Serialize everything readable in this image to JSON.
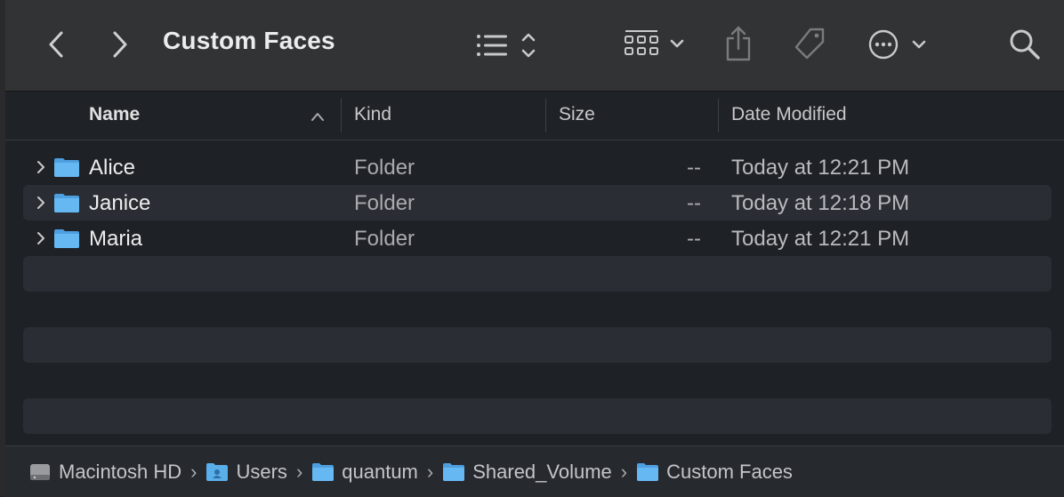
{
  "window": {
    "title": "Custom Faces"
  },
  "toolbar": {
    "back_icon": "chevron-left-icon",
    "forward_icon": "chevron-right-icon",
    "view_icon": "list-view-icon",
    "group_icon": "group-grid-icon",
    "share_icon": "share-icon",
    "tag_icon": "tag-icon",
    "more_icon": "ellipsis-circle-icon",
    "search_icon": "search-icon"
  },
  "columns": {
    "name": "Name",
    "kind": "Kind",
    "size": "Size",
    "date": "Date Modified"
  },
  "rows": [
    {
      "name": "Alice",
      "kind": "Folder",
      "size": "--",
      "date": "Today at 12:21 PM"
    },
    {
      "name": "Janice",
      "kind": "Folder",
      "size": "--",
      "date": "Today at 12:18 PM"
    },
    {
      "name": "Maria",
      "kind": "Folder",
      "size": "--",
      "date": "Today at 12:21 PM"
    }
  ],
  "path": [
    {
      "label": "Macintosh HD",
      "icon": "hard-drive-icon"
    },
    {
      "label": "Users",
      "icon": "users-folder-icon"
    },
    {
      "label": "quantum",
      "icon": "folder-icon"
    },
    {
      "label": "Shared_Volume",
      "icon": "folder-icon"
    },
    {
      "label": "Custom Faces",
      "icon": "folder-icon"
    }
  ],
  "colors": {
    "toolbar_bg": "#323335",
    "list_bg": "#1e2126",
    "alt_row": "#2a2d33",
    "folder_blue": "#5cb0ec"
  }
}
